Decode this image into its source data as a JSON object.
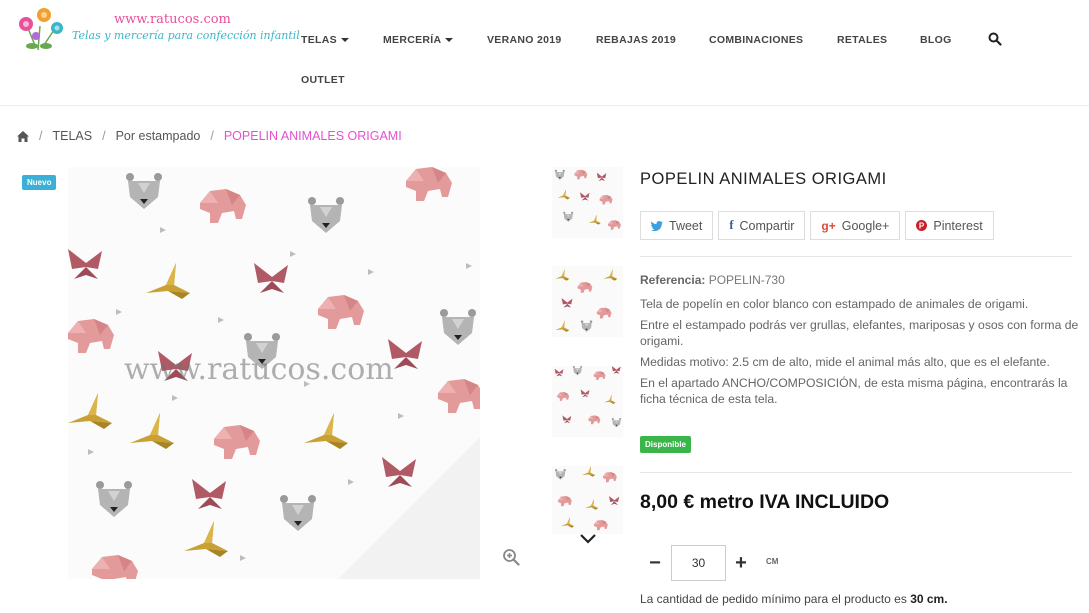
{
  "brand": {
    "url": "www.ratucos.com",
    "tagline": "Telas y mercería para confección infantil"
  },
  "nav": {
    "items": [
      {
        "label": "TELAS",
        "dropdown": true
      },
      {
        "label": "MERCERÍA",
        "dropdown": true
      },
      {
        "label": "VERANO 2019",
        "dropdown": false
      },
      {
        "label": "REBAJAS 2019",
        "dropdown": false
      },
      {
        "label": "COMBINACIONES",
        "dropdown": false
      },
      {
        "label": "RETALES",
        "dropdown": false
      },
      {
        "label": "BLOG",
        "dropdown": false
      },
      {
        "label": "OUTLET",
        "dropdown": false
      }
    ],
    "search_icon": "search-icon"
  },
  "breadcrumb": {
    "home_icon": "home-icon",
    "items": [
      "TELAS",
      "Por estampado"
    ],
    "current": "POPELIN ANIMALES ORIGAMI"
  },
  "gallery": {
    "badge": "Nuevo",
    "watermark": "www.ratucos.com",
    "zoom_icon": "zoom-in-icon",
    "thumbs_count_visible": 4,
    "arrow_icon": "chevron-down-icon"
  },
  "product": {
    "title": "POPELIN ANIMALES ORIGAMI",
    "share": [
      {
        "icon": "twitter-icon",
        "label": "Tweet"
      },
      {
        "icon": "facebook-icon",
        "label": "Compartir"
      },
      {
        "icon": "google-plus-icon",
        "label": "Google+"
      },
      {
        "icon": "pinterest-icon",
        "label": "Pinterest"
      }
    ],
    "reference_label": "Referencia:",
    "reference_value": "POPELIN-730",
    "description": [
      "Tela de popelín en color blanco con estampado de animales de origami.",
      "Entre el estampado podrás ver grullas, elefantes, mariposas y osos con forma de origami.",
      "Medidas motivo: 2.5 cm de alto, mide el animal más alto, que es el elefante.",
      "En el apartado ANCHO/COMPOSICIÓN, de esta misma página, encontrarás la ficha técnica de esta tela."
    ],
    "availability": "Disponible",
    "price": "8,00 € metro IVA INCLUIDO",
    "quantity": {
      "minus": "−",
      "plus": "+",
      "value": "30",
      "unit": "CM"
    },
    "min_note_prefix": "La cantidad de pedido mínimo para el producto es ",
    "min_note_value": "30 cm."
  },
  "colors": {
    "pink_accent": "#e84fd0",
    "new_badge": "#3bb0d6",
    "available": "#3ab54a",
    "elephant": "#e39a9a",
    "butterfly": "#b05a66",
    "crane": "#c8a033",
    "bear": "#a5a5a5"
  }
}
